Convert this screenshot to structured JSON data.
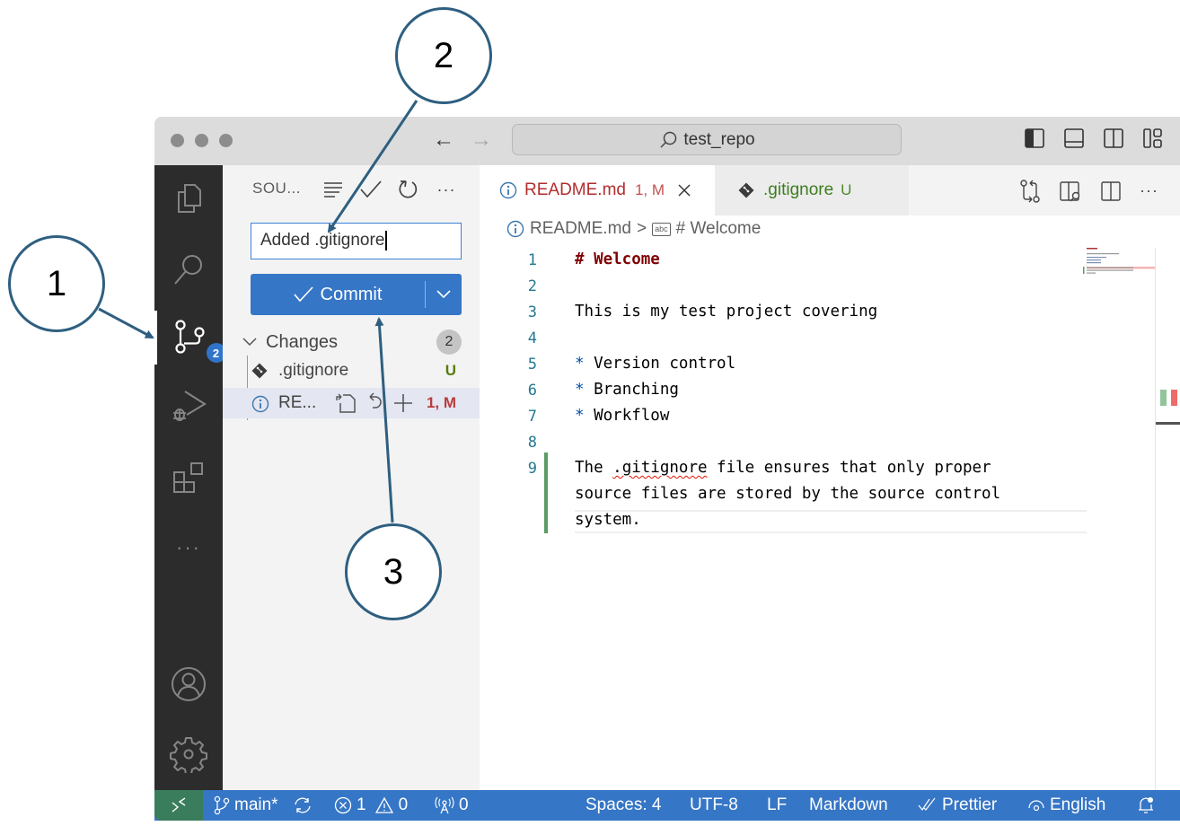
{
  "window": {
    "search_text": "test_repo",
    "nav": {
      "back": "←",
      "forward": "→"
    }
  },
  "activity_bar": {
    "items": [
      {
        "name": "explorer",
        "icon": "files-icon"
      },
      {
        "name": "search",
        "icon": "search-icon"
      },
      {
        "name": "source-control",
        "icon": "source-control-icon",
        "badge": "2",
        "active": true
      },
      {
        "name": "run-debug",
        "icon": "run-debug-icon"
      },
      {
        "name": "extensions",
        "icon": "extensions-icon"
      },
      {
        "name": "more",
        "icon": "ellipsis-icon",
        "label": "···"
      }
    ],
    "bottom": [
      {
        "name": "accounts",
        "icon": "account-icon"
      },
      {
        "name": "manage",
        "icon": "gear-icon"
      }
    ]
  },
  "sidebar": {
    "title": "SOU...",
    "actions": [
      "view-as-list",
      "commit",
      "refresh",
      "more-actions"
    ],
    "more_label": "···",
    "commit_message": "Added .gitignore",
    "commit_button": "Commit",
    "changes": {
      "label": "Changes",
      "count": "2",
      "files": [
        {
          "name": ".gitignore",
          "status": "U",
          "status_color": "#587c0c"
        },
        {
          "name": "RE...",
          "status": "1, M",
          "status_color": "#b83c3c"
        }
      ]
    }
  },
  "editor": {
    "tabs": [
      {
        "label": "README.md",
        "status": "1, M",
        "active": true,
        "color": "#b32d2d"
      },
      {
        "label": ".gitignore",
        "status": "U",
        "active": false,
        "color": "#3d7d1f"
      }
    ],
    "breadcrumb": {
      "file": "README.md",
      "separator": ">",
      "symbol": "# Welcome",
      "symbol_icon_label": "abc"
    },
    "lines": [
      {
        "n": "1",
        "text": "# Welcome"
      },
      {
        "n": "2",
        "text": ""
      },
      {
        "n": "3",
        "text": "This is my test project covering"
      },
      {
        "n": "4",
        "text": ""
      },
      {
        "n": "5",
        "bullet": "*",
        "text": "Version control"
      },
      {
        "n": "6",
        "bullet": "*",
        "text": "Branching"
      },
      {
        "n": "7",
        "bullet": "*",
        "text": "Workflow"
      },
      {
        "n": "8",
        "text": ""
      },
      {
        "n": "9",
        "text_a": "The ",
        "text_b": ".gitignore",
        "text_c": " file ensures that only proper",
        "wrap1": "source files are stored by the source control",
        "wrap2": "system."
      }
    ],
    "more_label": "···"
  },
  "statusbar": {
    "branch": "main*",
    "errors": "1",
    "warnings": "0",
    "ports": "0",
    "spaces": "Spaces: 4",
    "encoding": "UTF-8",
    "eol": "LF",
    "language": "Markdown",
    "formatter": "Prettier",
    "spell": "English"
  },
  "annotations": [
    {
      "label": "1"
    },
    {
      "label": "2"
    },
    {
      "label": "3"
    }
  ]
}
